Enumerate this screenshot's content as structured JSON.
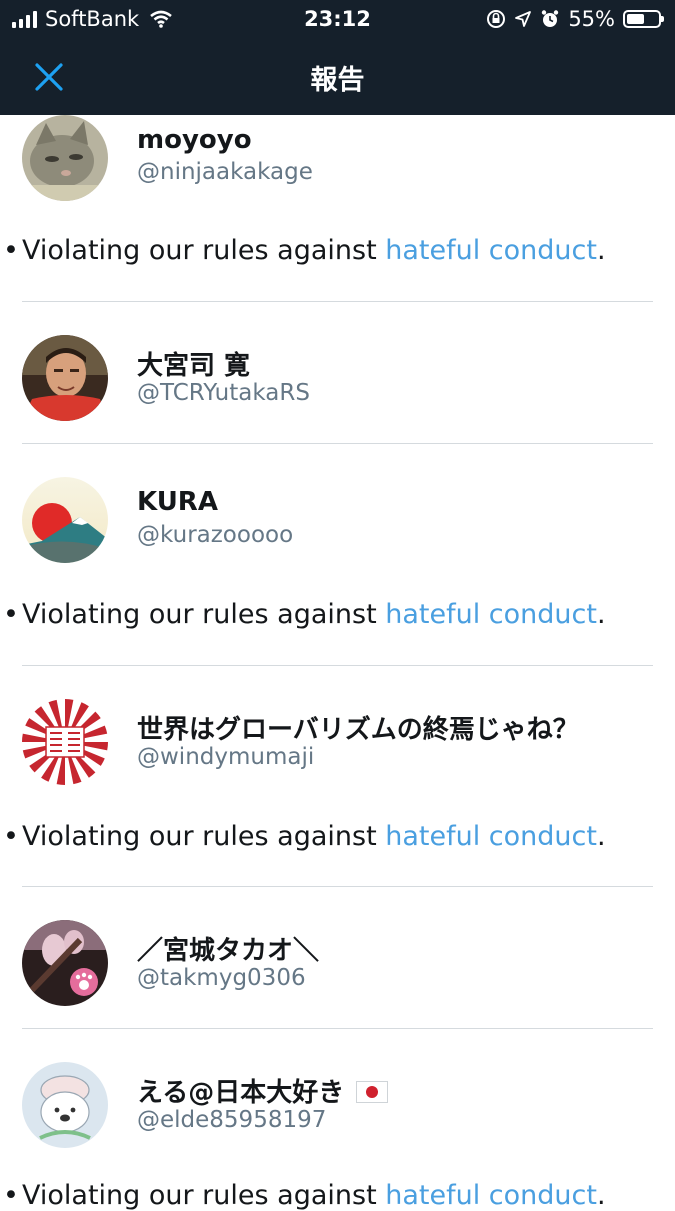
{
  "status_bar": {
    "carrier": "SoftBank",
    "time": "23:12",
    "battery": "55%",
    "battery_level": 0.55
  },
  "nav": {
    "title": "報告",
    "close_icon": "close-icon"
  },
  "violation": {
    "prefix": "Violating our rules against ",
    "link": "hateful conduct",
    "suffix": "."
  },
  "accounts": [
    {
      "name": "moyoyo",
      "handle": "@ninjaakakage",
      "avatar": "cat-photo"
    },
    {
      "name": "大宮司 寛",
      "handle": "@TCRYutakaRS",
      "avatar": "person-photo"
    },
    {
      "name": "KURA",
      "handle": "@kurazooooo",
      "avatar": "sun-mountain"
    },
    {
      "name": "世界はグローバリズムの終焉じゃね？",
      "handle": "@windymumaji",
      "avatar": "rising-sun-flag"
    },
    {
      "name": "／宮城タカオ＼",
      "handle": "@takmyg0306",
      "avatar": "paw-photo"
    },
    {
      "name": "える@日本大好き",
      "handle": "@elde85958197",
      "avatar": "bear-illustration",
      "flag_icon": "japan-flag-icon"
    }
  ],
  "colors": {
    "header_bg": "#15202b",
    "accent": "#1da1f2",
    "link": "#4a9fe0",
    "secondary_text": "#657786",
    "divider": "#d5dade"
  }
}
